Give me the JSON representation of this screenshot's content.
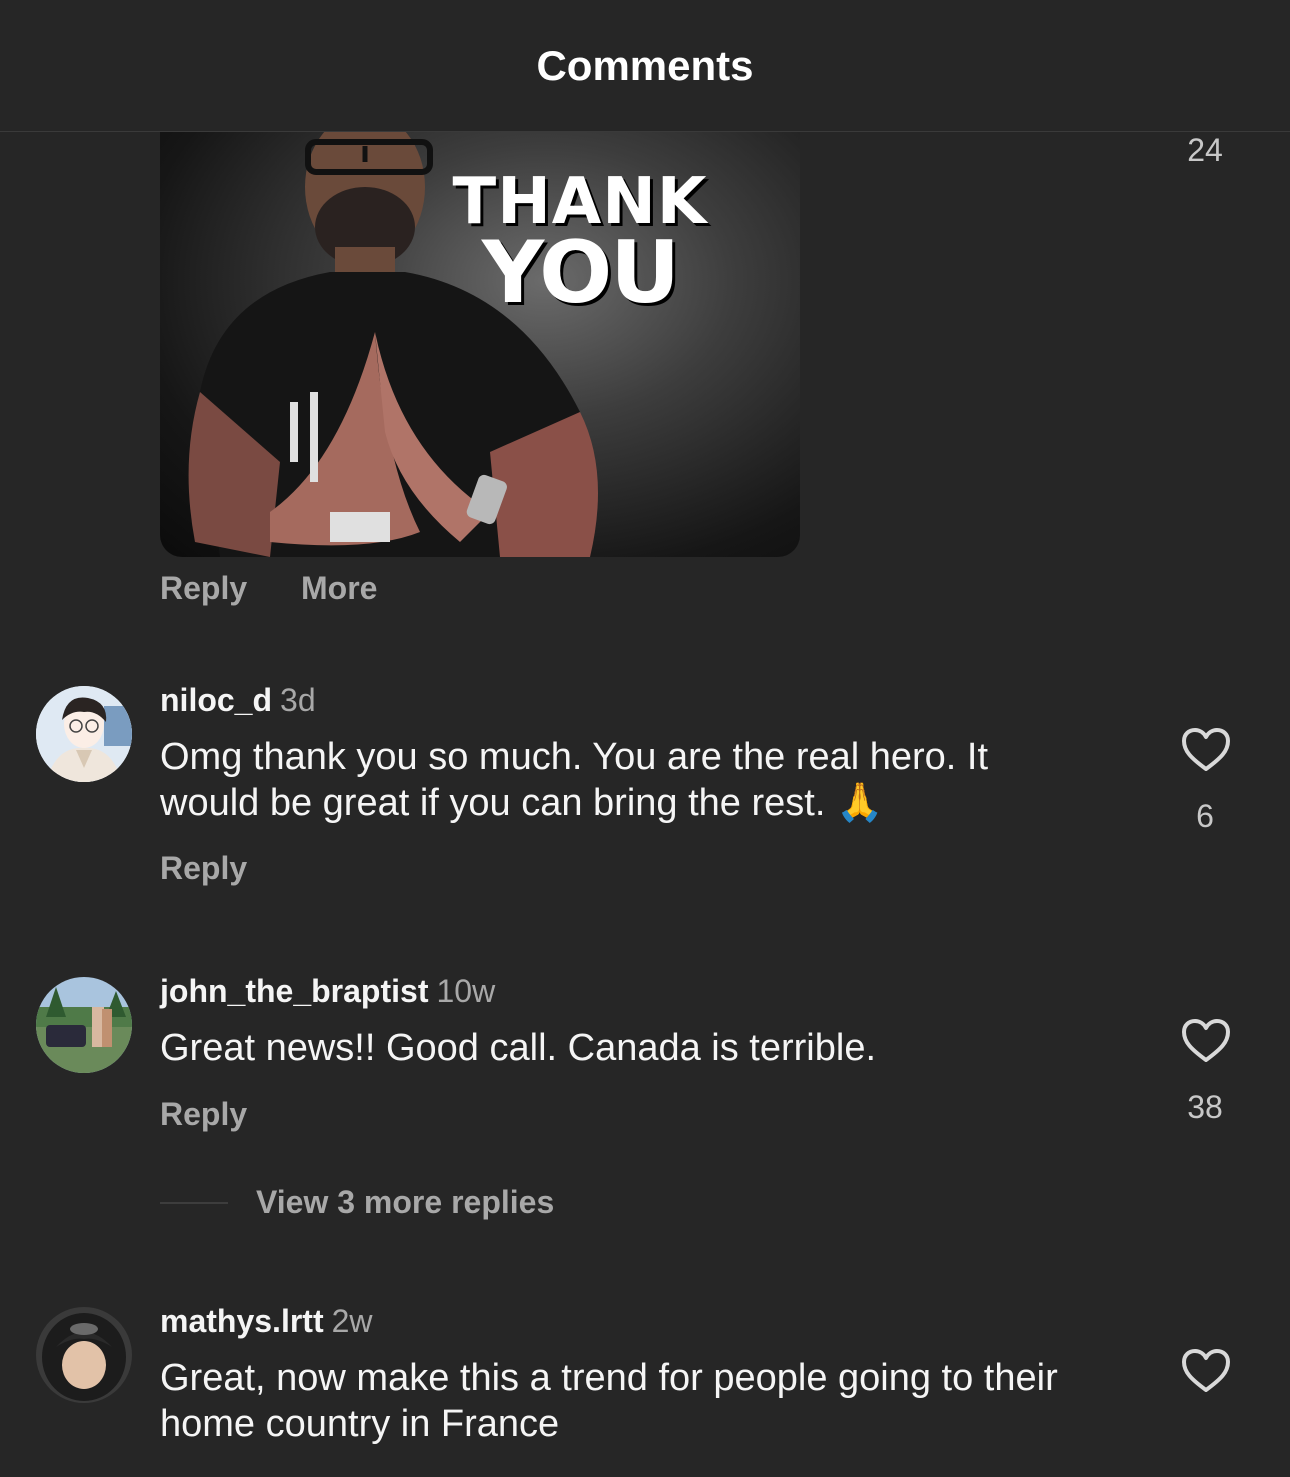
{
  "header": {
    "title": "Comments"
  },
  "gif_comment": {
    "gif_text_line1": "THANK",
    "gif_text_line2": "YOU",
    "like_count": "24",
    "reply_label": "Reply",
    "more_label": "More"
  },
  "comments": [
    {
      "username": "niloc_d",
      "time": "3d",
      "text": "Omg thank you so much. You are the real hero. It would be great if you can bring the rest. 🙏",
      "reply_label": "Reply",
      "like_count": "6"
    },
    {
      "username": "john_the_braptist",
      "time": "10w",
      "text": "Great news!! Good call. Canada is terrible.",
      "reply_label": "Reply",
      "like_count": "38",
      "view_replies": "View 3 more replies"
    },
    {
      "username": "mathys.lrtt",
      "time": "2w",
      "text": "Great, now make this a trend for people going to their home country in France"
    }
  ],
  "colors": {
    "background": "#262626",
    "secondary_text": "#a8a8a8",
    "primary_text": "#f5f5f5"
  },
  "icons": {
    "like": "heart-outline-icon"
  }
}
